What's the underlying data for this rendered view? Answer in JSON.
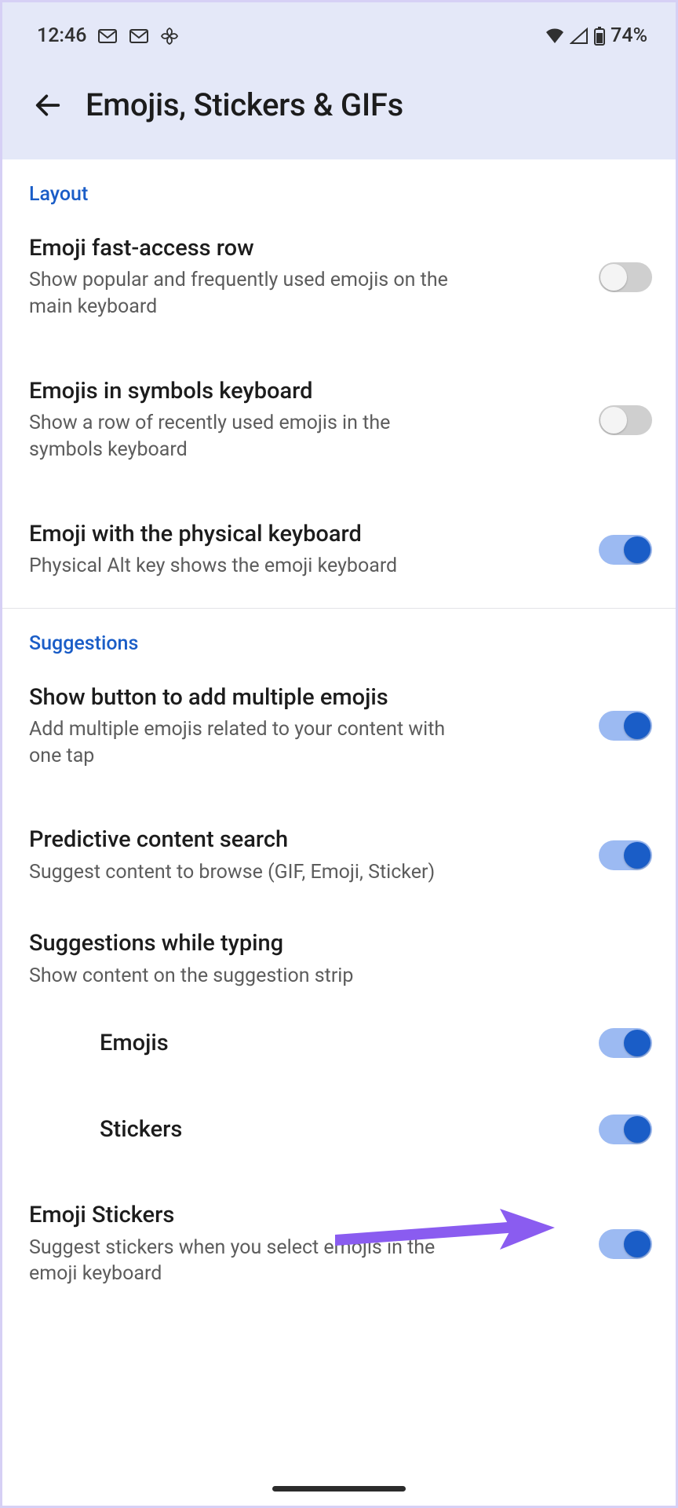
{
  "status": {
    "time": "12:46",
    "battery": "74%"
  },
  "header": {
    "title": "Emojis, Stickers & GIFs"
  },
  "sections": {
    "layout": {
      "label": "Layout",
      "items": [
        {
          "title": "Emoji fast-access row",
          "sub": "Show popular and frequently used emojis on the main keyboard",
          "toggle": "off"
        },
        {
          "title": "Emojis in symbols keyboard",
          "sub": "Show a row of recently used emojis in the symbols keyboard",
          "toggle": "off"
        },
        {
          "title": "Emoji with the physical keyboard",
          "sub": "Physical Alt key shows the emoji keyboard",
          "toggle": "on"
        }
      ]
    },
    "suggestions": {
      "label": "Suggestions",
      "items": [
        {
          "title": "Show button to add multiple emojis",
          "sub": "Add multiple emojis related to your content with one tap",
          "toggle": "on"
        },
        {
          "title": "Predictive content search",
          "sub": "Suggest content to browse (GIF, Emoji, Sticker)",
          "toggle": "on"
        }
      ],
      "typing_header": {
        "title": "Suggestions while typing",
        "sub": "Show content on the suggestion strip"
      },
      "typing_items": [
        {
          "title": "Emojis",
          "toggle": "on"
        },
        {
          "title": "Stickers",
          "toggle": "on"
        }
      ],
      "emoji_stickers": {
        "title": "Emoji Stickers",
        "sub": "Suggest stickers when you select emojis in the emoji keyboard",
        "toggle": "on"
      }
    }
  }
}
